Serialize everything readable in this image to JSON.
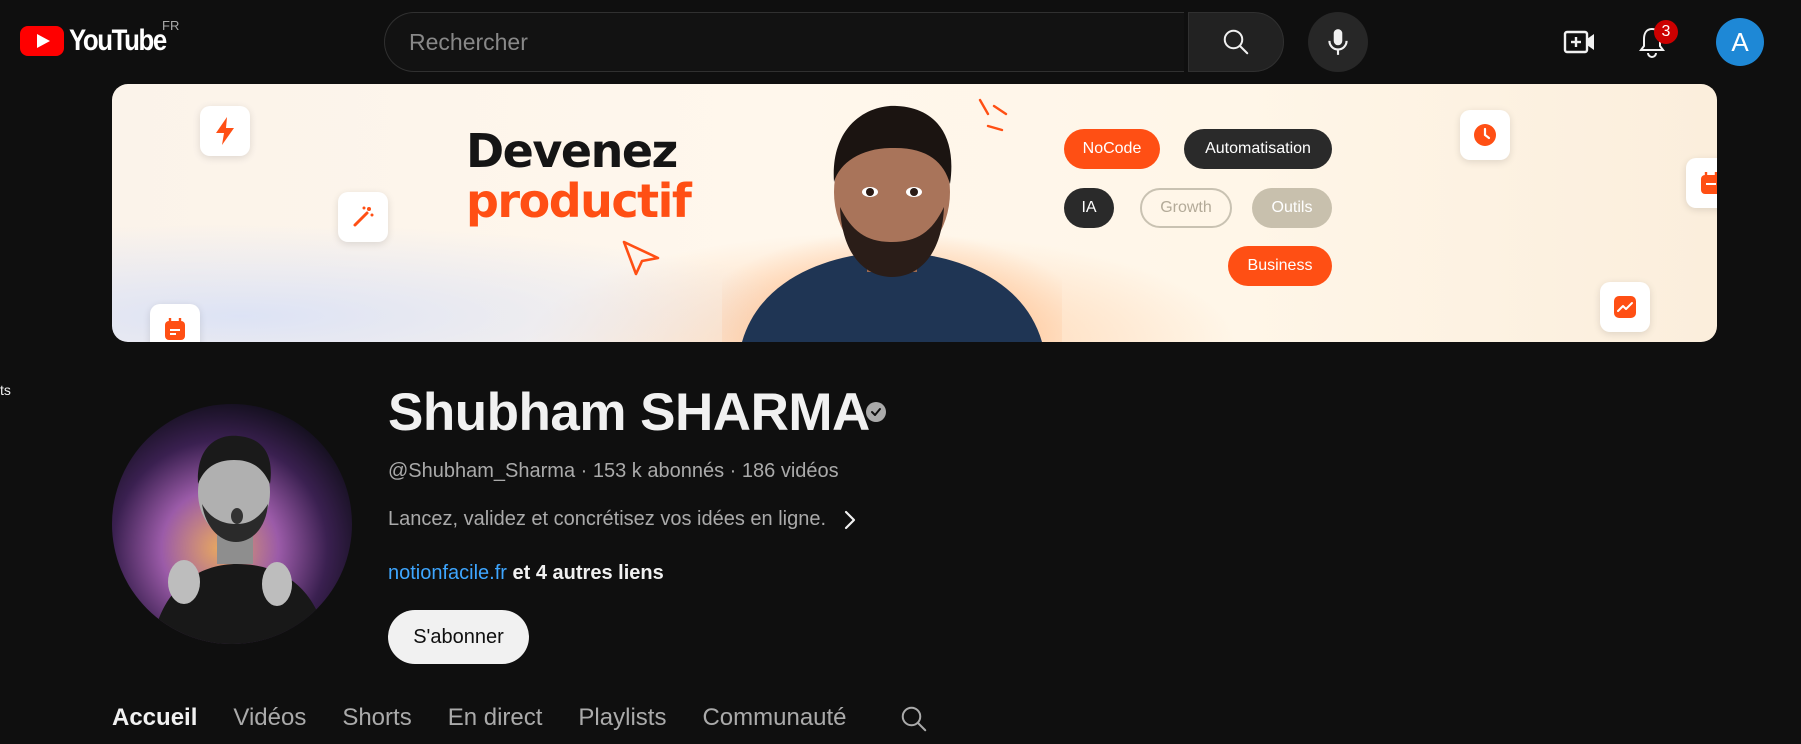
{
  "header": {
    "logo_text": "YouTube",
    "country_code": "FR",
    "search_placeholder": "Rechercher",
    "notification_count": "3",
    "avatar_letter": "A"
  },
  "banner": {
    "title_line1": "Devenez",
    "title_line2": "productif",
    "tags": [
      "NoCode",
      "Automatisation",
      "IA",
      "Growth",
      "Outils",
      "Business"
    ],
    "accent_color": "#ff4f14"
  },
  "sidebar_fragment": "ts",
  "channel": {
    "name": "Shubham SHARMA",
    "handle": "@Shubham_Sharma",
    "subscribers": "153 k abonnés",
    "videos": "186 vidéos",
    "separator": "·",
    "description": "Lancez, validez et concrétisez vos idées en ligne.",
    "link_main": "notionfacile.fr",
    "link_more": "et 4 autres liens",
    "subscribe_label": "S'abonner"
  },
  "tabs": [
    "Accueil",
    "Vidéos",
    "Shorts",
    "En direct",
    "Playlists",
    "Communauté"
  ],
  "icons": {
    "search": "search-icon",
    "mic": "mic-icon",
    "create": "create-video-icon",
    "notifications": "bell-icon",
    "verified": "verified-check-icon",
    "description_more": "chevron-right-icon",
    "tab_search": "search-icon"
  }
}
